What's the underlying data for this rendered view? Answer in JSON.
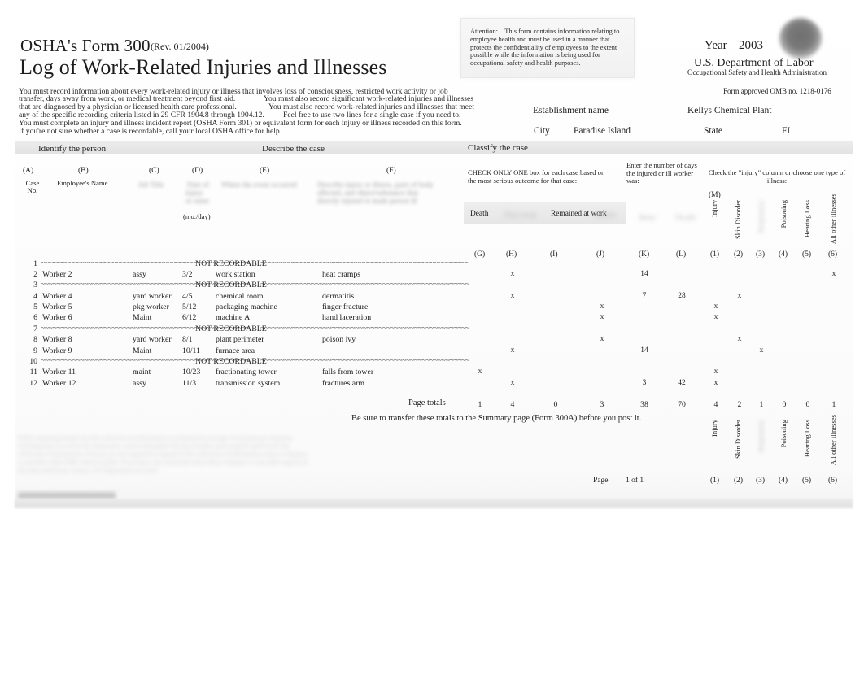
{
  "form": {
    "form_number": "OSHA's Form 300",
    "revision": "(Rev. 01/2004)",
    "title": "Log of Work-Related Injuries and Illnesses",
    "intro_lines": [
      "You must record information about every work-related injury or illness that involves loss of consciousness, restricted work activity or job",
      "transfer, days away from work, or medical treatment beyond first aid.",
      "You must also record significant work-related injuries and illnesses",
      "that are diagnosed by a physician or licensed health care professional.",
      "You must also record work-related injuries and illnesses that meet",
      "any of the specific recording criteria listed in 29 CFR 1904.8 through 1904.12.",
      "Feel free to use two lines for a single case if you need to.",
      "You must complete an injury and illness incident report (OSHA Form 301) or equivalent form for each injury or illness recorded on this form.",
      " If you're not sure whether a case is recordable, call your local OSHA office for help."
    ]
  },
  "attention": {
    "label": "Attention:",
    "text": "This form contains information relating to employee health and must be used in a manner that protects the confidentiality of employees to the extent possible while the information is being used for occupational safety and health purposes."
  },
  "agency": {
    "year_label": "Year",
    "year_value": "2003",
    "department": "U.S. Department of Labor",
    "administration": "Occupational Safety and Health Administration",
    "omb": "Form approved OMB no. 1218-0176",
    "seal_icon": "dol-seal-icon"
  },
  "establishment": {
    "name_label": "Establishment name",
    "name_value": "Kellys Chemical Plant",
    "city_label": "City",
    "city_value": "Paradise Island",
    "state_label": "State",
    "state_value": "FL"
  },
  "sections": {
    "identify": "Identify the person",
    "describe": "Describe the case",
    "classify": "Classify the case"
  },
  "classify_instructions": {
    "check_one": "CHECK ONLY ONE   box for each case based on the most serious outcome for that case:",
    "days": "Enter the number of days the injured or ill worker was:",
    "illness": "Check the \"injury\" column or choose one type of illness:"
  },
  "left_columns": {
    "letters": [
      "(A)",
      "(B)",
      "(C)",
      "(D)",
      "(E)",
      "(F)"
    ],
    "a_label": "Case\nNo.",
    "a_line1": "Case",
    "a_line2": "No.",
    "b_label": "Employee's Name",
    "d_sub": "(mo./day)"
  },
  "classify_columns": {
    "letters": [
      "(G)",
      "(H)",
      "(I)",
      "(J)",
      "(K)",
      "(L)"
    ],
    "death": "Death",
    "remained": "Remained at work",
    "m_letter": "(M)"
  },
  "illness_columns": {
    "numbers": [
      "(1)",
      "(2)",
      "(3)",
      "(4)",
      "(5)",
      "(6)"
    ],
    "labels": [
      "Injury",
      "Skin Disorder",
      "",
      "Poisoning",
      "Hearing Loss",
      "All other illnesses"
    ]
  },
  "not_recordable_text": "NOT RECORDABLE",
  "rows": [
    {
      "case": "1",
      "not_recordable": true,
      "name": "",
      "title": "",
      "date": "",
      "where": "",
      "desc": ""
    },
    {
      "case": "2",
      "not_recordable": false,
      "name": "Worker 2",
      "title": "assy",
      "date": "3/2",
      "where": "work station",
      "desc": "heat cramps"
    },
    {
      "case": "3",
      "not_recordable": true,
      "name": "",
      "title": "",
      "date": "",
      "where": "",
      "desc": ""
    },
    {
      "case": "4",
      "not_recordable": false,
      "name": "Worker 4",
      "title": "yard worker",
      "date": "4/5",
      "where": "chemical room",
      "desc": "dermatitis"
    },
    {
      "case": "5",
      "not_recordable": false,
      "name": "Worker 5",
      "title": "pkg worker",
      "date": "5/12",
      "where": "packaging machine",
      "desc": "finger fracture"
    },
    {
      "case": "6",
      "not_recordable": false,
      "name": "Worker 6",
      "title": "Maint",
      "date": "6/12",
      "where": "machine A",
      "desc": "hand laceration"
    },
    {
      "case": "7",
      "not_recordable": true,
      "name": "",
      "title": "",
      "date": "",
      "where": "",
      "desc": ""
    },
    {
      "case": "8",
      "not_recordable": false,
      "name": "Worker 8",
      "title": "yard worker",
      "date": "8/1",
      "where": "plant perimeter",
      "desc": "poison ivy"
    },
    {
      "case": "9",
      "not_recordable": false,
      "name": "Worker 9",
      "title": "Maint",
      "date": "10/11",
      "where": "furnace area",
      "desc": ""
    },
    {
      "case": "10",
      "not_recordable": true,
      "name": "",
      "title": "",
      "date": "",
      "where": "",
      "desc": ""
    },
    {
      "case": "11",
      "not_recordable": false,
      "name": "Worker 11",
      "title": "maint",
      "date": "10/23",
      "where": "fractionating tower",
      "desc": "falls from tower"
    },
    {
      "case": "12",
      "not_recordable": false,
      "name": "Worker 12",
      "title": "assy",
      "date": "11/3",
      "where": "transmission system",
      "desc": "fractures arm"
    }
  ],
  "classify_rows": [
    {
      "G": "",
      "H": "",
      "I": "",
      "J": "",
      "K": "",
      "L": "",
      "c1": "",
      "c2": "",
      "c3": "",
      "c4": "",
      "c5": "",
      "c6": ""
    },
    {
      "G": "",
      "H": "x",
      "I": "",
      "J": "",
      "K": "14",
      "L": "",
      "c1": "",
      "c2": "",
      "c3": "",
      "c4": "",
      "c5": "",
      "c6": "x"
    },
    {
      "G": "",
      "H": "",
      "I": "",
      "J": "",
      "K": "",
      "L": "",
      "c1": "",
      "c2": "",
      "c3": "",
      "c4": "",
      "c5": "",
      "c6": ""
    },
    {
      "G": "",
      "H": "x",
      "I": "",
      "J": "",
      "K": "7",
      "L": "28",
      "c1": "",
      "c2": "x",
      "c3": "",
      "c4": "",
      "c5": "",
      "c6": ""
    },
    {
      "G": "",
      "H": "",
      "I": "",
      "J": "x",
      "K": "",
      "L": "",
      "c1": "x",
      "c2": "",
      "c3": "",
      "c4": "",
      "c5": "",
      "c6": ""
    },
    {
      "G": "",
      "H": "",
      "I": "",
      "J": "x",
      "K": "",
      "L": "",
      "c1": "x",
      "c2": "",
      "c3": "",
      "c4": "",
      "c5": "",
      "c6": ""
    },
    {
      "G": "",
      "H": "",
      "I": "",
      "J": "",
      "K": "",
      "L": "",
      "c1": "",
      "c2": "",
      "c3": "",
      "c4": "",
      "c5": "",
      "c6": ""
    },
    {
      "G": "",
      "H": "",
      "I": "",
      "J": "x",
      "K": "",
      "L": "",
      "c1": "",
      "c2": "x",
      "c3": "",
      "c4": "",
      "c5": "",
      "c6": ""
    },
    {
      "G": "",
      "H": "x",
      "I": "",
      "J": "",
      "K": "14",
      "L": "",
      "c1": "",
      "c2": "",
      "c3": "x",
      "c4": "",
      "c5": "",
      "c6": ""
    },
    {
      "G": "",
      "H": "",
      "I": "",
      "J": "",
      "K": "",
      "L": "",
      "c1": "",
      "c2": "",
      "c3": "",
      "c4": "",
      "c5": "",
      "c6": ""
    },
    {
      "G": "x",
      "H": "",
      "I": "",
      "J": "",
      "K": "",
      "L": "",
      "c1": "x",
      "c2": "",
      "c3": "",
      "c4": "",
      "c5": "",
      "c6": ""
    },
    {
      "G": "",
      "H": "x",
      "I": "",
      "J": "",
      "K": "3",
      "L": "42",
      "c1": "x",
      "c2": "",
      "c3": "",
      "c4": "",
      "c5": "",
      "c6": ""
    }
  ],
  "totals": {
    "label": "Page totals",
    "values": [
      "1",
      "4",
      "0",
      "3",
      "38",
      "70",
      "4",
      "2",
      "1",
      "0",
      "0",
      "1"
    ]
  },
  "transfer_note": "Be sure to transfer these totals to the Summary page (Form 300A) before you post it.",
  "page_footer": {
    "page_label": "Page",
    "page_value": "1 of 1"
  }
}
